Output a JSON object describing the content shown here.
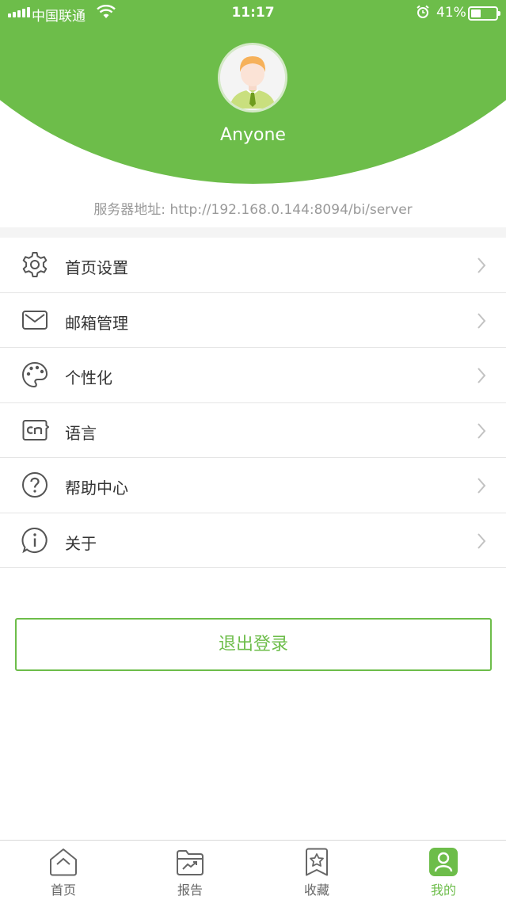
{
  "status_bar": {
    "carrier": "中国联通",
    "time": "11:17",
    "battery_percent_text": "41%",
    "battery_level": 0.41,
    "icons": [
      "signal-icon",
      "wifi-icon",
      "alarm-icon",
      "battery-icon"
    ]
  },
  "profile": {
    "username": "Anyone",
    "avatar_icon": "user-avatar"
  },
  "server": {
    "text": "服务器地址: http://192.168.0.144:8094/bi/server"
  },
  "menu": {
    "items": [
      {
        "label": "首页设置",
        "icon": "gear-icon"
      },
      {
        "label": "邮箱管理",
        "icon": "mail-icon"
      },
      {
        "label": "个性化",
        "icon": "palette-icon"
      },
      {
        "label": "语言",
        "icon": "language-cn-icon"
      },
      {
        "label": "帮助中心",
        "icon": "help-icon"
      },
      {
        "label": "关于",
        "icon": "info-icon"
      }
    ]
  },
  "logout": {
    "label": "退出登录"
  },
  "tabbar": {
    "tabs": [
      {
        "label": "首页",
        "icon": "home-icon",
        "active": false
      },
      {
        "label": "报告",
        "icon": "report-folder-icon",
        "active": false
      },
      {
        "label": "收藏",
        "icon": "favorites-icon",
        "active": false
      },
      {
        "label": "我的",
        "icon": "profile-icon",
        "active": true
      }
    ]
  },
  "colors": {
    "accent": "#6dbd4a",
    "text": "#333333",
    "muted": "#999999",
    "divider": "#e5e5e5"
  }
}
